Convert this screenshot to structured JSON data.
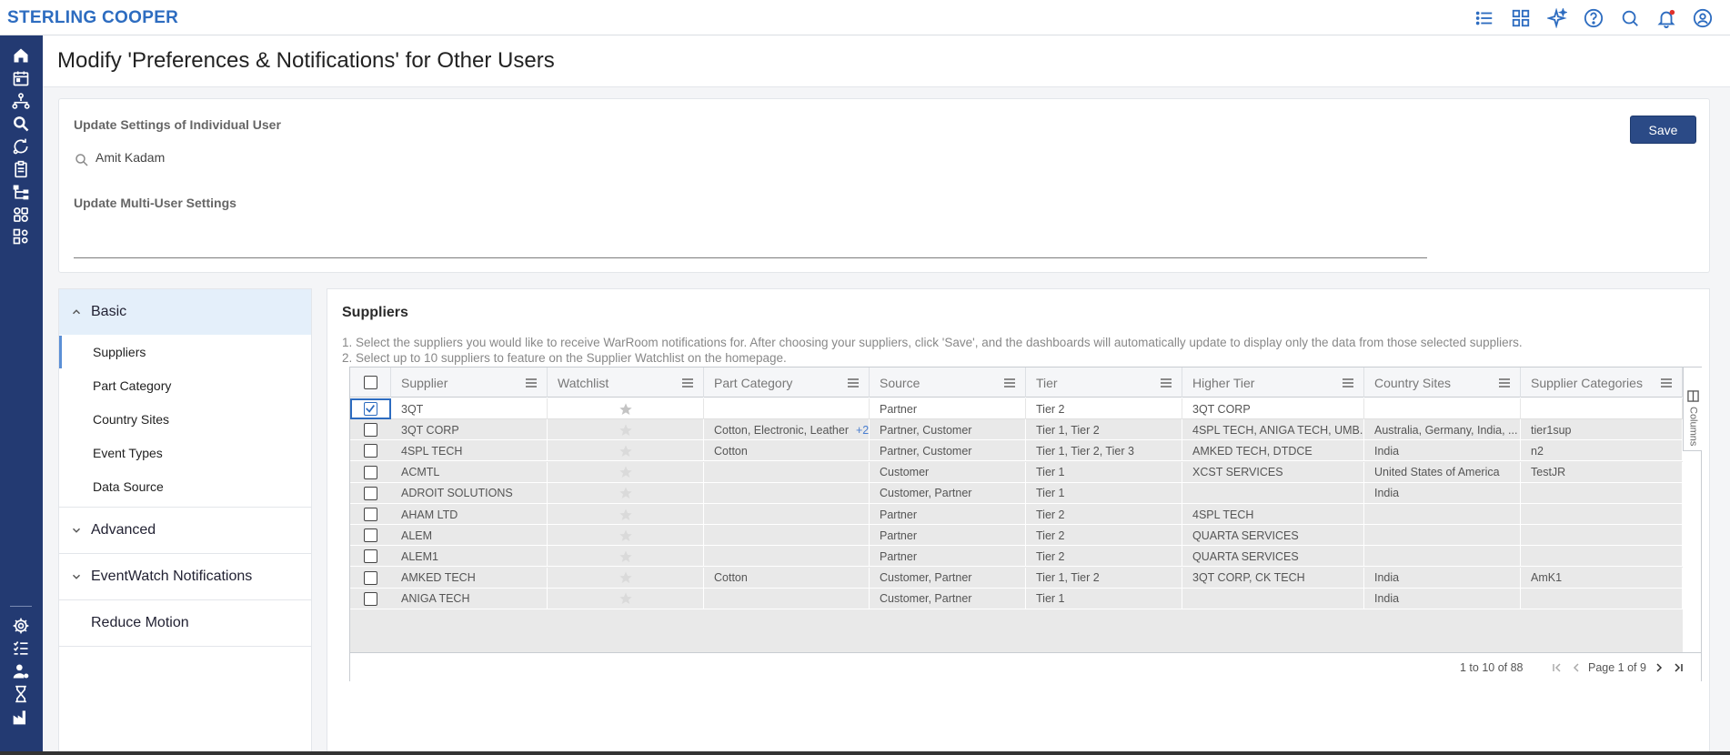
{
  "brand": "STERLING COOPER",
  "page_title": "Modify 'Preferences & Notifications' for Other Users",
  "settings": {
    "individual_label": "Update Settings of Individual User",
    "user_value": "Amit Kadam",
    "multi_label": "Update Multi-User Settings",
    "save_label": "Save"
  },
  "side_panel": {
    "basic": "Basic",
    "basic_items": [
      "Suppliers",
      "Part Category",
      "Country Sites",
      "Event Types",
      "Data Source"
    ],
    "advanced": "Advanced",
    "eventwatch": "EventWatch Notifications",
    "reduce_motion": "Reduce Motion"
  },
  "main": {
    "title": "Suppliers",
    "instruction_1": "1. Select the suppliers you would like to receive WarRoom notifications for. After choosing your suppliers, click 'Save', and the dashboards will automatically update to display only the data from those selected suppliers.",
    "instruction_2": "2. Select up to 10 suppliers to feature on the Supplier Watchlist on the homepage."
  },
  "grid": {
    "columns": [
      "Supplier",
      "Watchlist",
      "Part Category",
      "Source",
      "Tier",
      "Higher Tier",
      "Country Sites",
      "Supplier Categories"
    ],
    "rows": [
      {
        "checked": true,
        "supplier": "3QT",
        "part": "",
        "more": "",
        "source": "Partner",
        "tier": "Tier 2",
        "higher": "3QT CORP",
        "country": "",
        "categories": ""
      },
      {
        "checked": false,
        "supplier": "3QT CORP",
        "part": "Cotton, Electronic, Leather",
        "more": "+2",
        "source": "Partner, Customer",
        "tier": "Tier 1, Tier 2",
        "higher": "4SPL TECH, ANIGA TECH, UMB...",
        "country": "Australia, Germany, India, ...",
        "categories": "tier1sup"
      },
      {
        "checked": false,
        "supplier": "4SPL TECH",
        "part": "Cotton",
        "more": "",
        "source": "Partner, Customer",
        "tier": "Tier 1, Tier 2, Tier 3",
        "higher": "AMKED TECH, DTDCE",
        "country": "India",
        "categories": "n2"
      },
      {
        "checked": false,
        "supplier": "ACMTL",
        "part": "",
        "more": "",
        "source": "Customer",
        "tier": "Tier 1",
        "higher": "XCST SERVICES",
        "country": "United States of America",
        "categories": "TestJR"
      },
      {
        "checked": false,
        "supplier": "ADROIT SOLUTIONS",
        "part": "",
        "more": "",
        "source": "Customer, Partner",
        "tier": "Tier 1",
        "higher": "",
        "country": "India",
        "categories": ""
      },
      {
        "checked": false,
        "supplier": "AHAM LTD",
        "part": "",
        "more": "",
        "source": "Partner",
        "tier": "Tier 2",
        "higher": "4SPL TECH",
        "country": "",
        "categories": ""
      },
      {
        "checked": false,
        "supplier": "ALEM",
        "part": "",
        "more": "",
        "source": "Partner",
        "tier": "Tier 2",
        "higher": "QUARTA SERVICES",
        "country": "",
        "categories": ""
      },
      {
        "checked": false,
        "supplier": "ALEM1",
        "part": "",
        "more": "",
        "source": "Partner",
        "tier": "Tier 2",
        "higher": "QUARTA SERVICES",
        "country": "",
        "categories": ""
      },
      {
        "checked": false,
        "supplier": "AMKED TECH",
        "part": "Cotton",
        "more": "",
        "source": "Customer, Partner",
        "tier": "Tier 1, Tier 2",
        "higher": "3QT CORP, CK TECH",
        "country": "India",
        "categories": "AmK1"
      },
      {
        "checked": false,
        "supplier": "ANIGA TECH",
        "part": "",
        "more": "",
        "source": "Customer, Partner",
        "tier": "Tier 1",
        "higher": "",
        "country": "India",
        "categories": ""
      }
    ],
    "columns_tab": "Columns",
    "pagination_summary": "1 to 10 of 88",
    "page_label": "Page 1 of 9"
  },
  "colors": {
    "rail": "#233a72",
    "accent": "#2d6cc0",
    "save_button": "#2b4a86",
    "active_section": "#e4effa",
    "notification_dot": "#e0312b"
  },
  "icons": {
    "top": [
      "list-icon",
      "dashboard-icon",
      "sparkle-icon",
      "help-icon",
      "search-icon",
      "bell-icon",
      "user-circle-icon"
    ],
    "rail": [
      "home-icon",
      "calendar-icon",
      "network-icon",
      "search-icon",
      "refresh-icon",
      "clipboard-icon",
      "hierarchy-icon",
      "apps-icon",
      "settings-grid-icon",
      "gear-icon",
      "checklist-icon",
      "user-gear-icon",
      "hourglass-icon",
      "factory-icon"
    ]
  }
}
